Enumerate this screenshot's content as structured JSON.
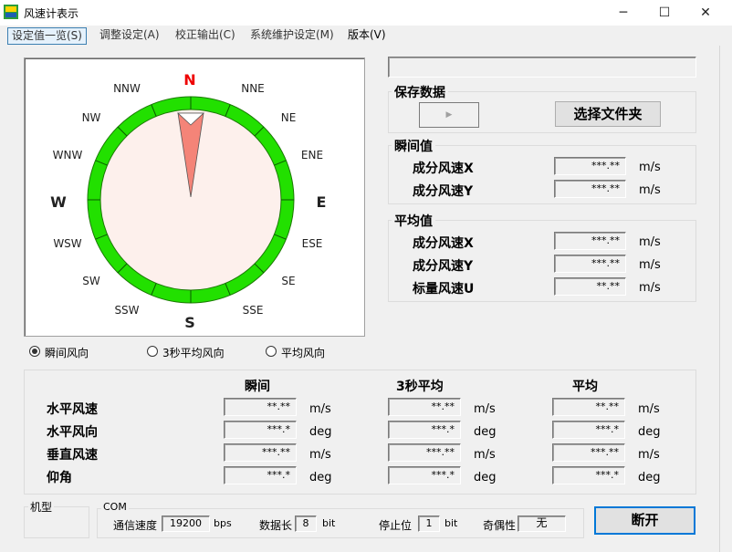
{
  "window": {
    "title": "风速计表示",
    "min_icon": "─",
    "max_icon": "☐",
    "close_icon": "✕"
  },
  "menu": [
    {
      "label": "设定值一览(S)"
    },
    {
      "label": "调整设定(A)"
    },
    {
      "label": "校正输出(C)"
    },
    {
      "label": "系统维护设定(M)"
    },
    {
      "label": "版本(V)"
    }
  ],
  "compass": {
    "N": "N",
    "NNE": "NNE",
    "NE": "NE",
    "ENE": "ENE",
    "E": "E",
    "ESE": "ESE",
    "SE": "SE",
    "SSE": "SSE",
    "S": "S",
    "SSW": "SSW",
    "SW": "SW",
    "WSW": "WSW",
    "W": "W",
    "WNW": "WNW",
    "NW": "NW",
    "NNW": "NNW",
    "ring_color": "#22e000",
    "needle_color": "#f48478",
    "face_color": "#fdf0ec",
    "north_color": "#ee0000"
  },
  "radios": [
    {
      "label": "瞬间风向",
      "checked": true
    },
    {
      "label": "3秒平均风向",
      "checked": false
    },
    {
      "label": "平均风向",
      "checked": false
    }
  ],
  "status_field": "",
  "save": {
    "title": "保存数据",
    "play_icon": "▶",
    "folder_button": "选择文件夹"
  },
  "instant": {
    "title": "瞬间值",
    "rows": [
      {
        "label": "成分风速X",
        "value": "***.**",
        "unit": "m/s"
      },
      {
        "label": "成分风速Y",
        "value": "***.**",
        "unit": "m/s"
      }
    ]
  },
  "average": {
    "title": "平均值",
    "rows": [
      {
        "label": "成分风速X",
        "value": "***.**",
        "unit": "m/s"
      },
      {
        "label": "成分风速Y",
        "value": "***.**",
        "unit": "m/s"
      },
      {
        "label": "标量风速U",
        "value": "**.**",
        "unit": "m/s"
      }
    ]
  },
  "table": {
    "headers": [
      "瞬间",
      "3秒平均",
      "平均"
    ],
    "rows": [
      {
        "label": "水平风速",
        "cells": [
          {
            "v": "**.**",
            "u": "m/s"
          },
          {
            "v": "**.**",
            "u": "m/s"
          },
          {
            "v": "**.**",
            "u": "m/s"
          }
        ]
      },
      {
        "label": "水平风向",
        "cells": [
          {
            "v": "***.*",
            "u": "deg"
          },
          {
            "v": "***.*",
            "u": "deg"
          },
          {
            "v": "***.*",
            "u": "deg"
          }
        ]
      },
      {
        "label": "垂直风速",
        "cells": [
          {
            "v": "***.**",
            "u": "m/s"
          },
          {
            "v": "***.**",
            "u": "m/s"
          },
          {
            "v": "***.**",
            "u": "m/s"
          }
        ]
      },
      {
        "label": "仰角",
        "cells": [
          {
            "v": "***.*",
            "u": "deg"
          },
          {
            "v": "***.*",
            "u": "deg"
          },
          {
            "v": "***.*",
            "u": "deg"
          }
        ]
      }
    ]
  },
  "model": {
    "title": "机型"
  },
  "com": {
    "title": "COM",
    "baud_label": "通信速度",
    "baud": "19200",
    "baud_unit": "bps",
    "data_label": "数据长",
    "data": "8",
    "data_unit": "bit",
    "stop_label": "停止位",
    "stop": "1",
    "stop_unit": "bit",
    "parity_label": "奇偶性",
    "parity": "无"
  },
  "disconnect_button": "断开"
}
